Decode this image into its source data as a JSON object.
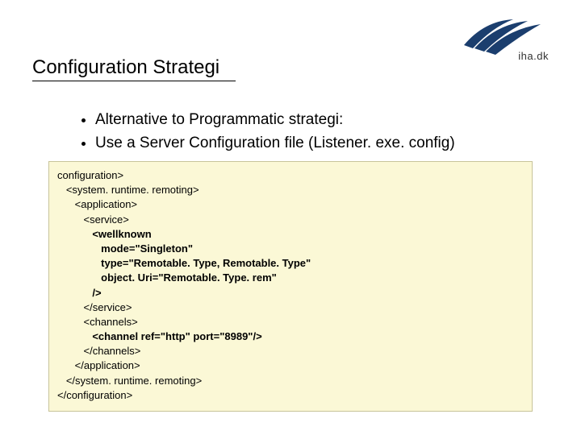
{
  "logo": {
    "text": "iha.dk"
  },
  "title": "Configuration Strategi",
  "bullets": {
    "items": [
      {
        "text": "Alternative to Programmatic strategi:"
      },
      {
        "text": "Use a Server Configuration file (Listener. exe. config)"
      }
    ]
  },
  "code": {
    "lines": [
      {
        "indent": 0,
        "text": "configuration>",
        "bold": false
      },
      {
        "indent": 1,
        "text": "<system. runtime. remoting>",
        "bold": false
      },
      {
        "indent": 2,
        "text": "<application>",
        "bold": false
      },
      {
        "indent": 3,
        "text": "<service>",
        "bold": false
      },
      {
        "indent": 4,
        "text": "<wellknown",
        "bold": true
      },
      {
        "indent": 5,
        "text": "mode=\"Singleton\"",
        "bold": true
      },
      {
        "indent": 5,
        "text": "type=\"Remotable. Type, Remotable. Type\"",
        "bold": true
      },
      {
        "indent": 5,
        "text": "object. Uri=\"Remotable. Type. rem\"",
        "bold": true
      },
      {
        "indent": 4,
        "text": "/>",
        "bold": true
      },
      {
        "indent": 3,
        "text": "</service>",
        "bold": false
      },
      {
        "indent": 3,
        "text": "<channels>",
        "bold": false
      },
      {
        "indent": 4,
        "text": "<channel ref=\"http\" port=\"8989\"/>",
        "bold": true
      },
      {
        "indent": 3,
        "text": "</channels>",
        "bold": false
      },
      {
        "indent": 2,
        "text": "</application>",
        "bold": false
      },
      {
        "indent": 1,
        "text": "</system. runtime. remoting>",
        "bold": false
      },
      {
        "indent": 0,
        "text": "</configuration>",
        "bold": false
      }
    ]
  }
}
